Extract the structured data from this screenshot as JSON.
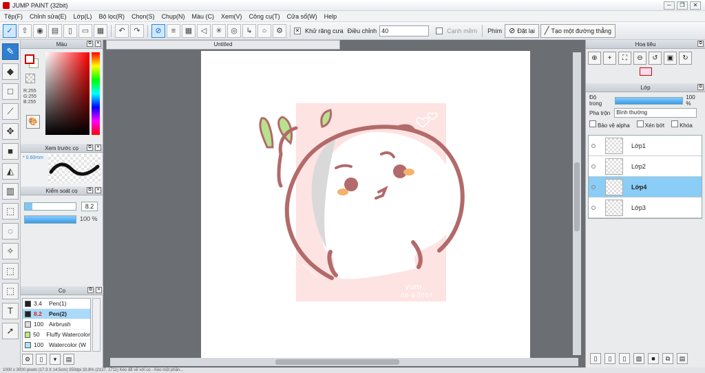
{
  "window": {
    "title": "JUMP PAINT (32bit)",
    "minimize": "─",
    "restore": "❐",
    "close": "✕"
  },
  "menu": [
    "Tệp(F)",
    "Chỉnh sửa(E)",
    "Lớp(L)",
    "Bộ lọc(R)",
    "Chọn(S)",
    "Chụp(N)",
    "Màu (C)",
    "Xem(V)",
    "Công cụ(T)",
    "Cửa sổ(W)",
    "Help"
  ],
  "toolbar": {
    "antialias_label": "Khử răng cưa",
    "adjust_label": "Điều chỉnh",
    "adjust_value": "40",
    "smooth_label": "Cạnh mềm",
    "key_label": "Phím",
    "reset_label": "Đặt lại",
    "straight_line_label": "Tạo một đường thẳng"
  },
  "color_panel": {
    "title": "Màu",
    "r": "R:255",
    "g": "G:255",
    "b": "B:255"
  },
  "preview_panel": {
    "title": "Xem trước cọ",
    "size": "* 0.60mm"
  },
  "brush_control": {
    "title": "Kiểm soát cọ",
    "size_value": "8.2",
    "opacity_value": "100 %",
    "size_fraction": 0.15
  },
  "brush_panel": {
    "title": "Cọ",
    "items": [
      {
        "size": "3.4",
        "name": "Pen(1)",
        "color": "#222222"
      },
      {
        "size": "8.2",
        "name": "Pen(2)",
        "color": "#222222"
      },
      {
        "size": "100",
        "name": "Airbrush",
        "color": "#dddddd"
      },
      {
        "size": "50",
        "name": "Fluffy Watercolor",
        "color": "#b8e986"
      },
      {
        "size": "100",
        "name": "Watercolor (W",
        "color": "#a8e4f6"
      }
    ]
  },
  "document": {
    "tab": "Untitled",
    "signature": "yum",
    "date": "08-4-2017"
  },
  "navigator": {
    "title": "Hoa tiêu"
  },
  "layer_panel": {
    "title": "Lớp",
    "opacity_label": "Độ trong",
    "opacity_value": "100 %",
    "blend_label": "Pha trộn",
    "blend_value": "Bình thường",
    "protect_alpha": "Bảo vệ alpha",
    "clip": "Xén bớt",
    "lock": "Khóa",
    "layers": [
      "Lớp1",
      "Lớp2",
      "Lớp4",
      "Lớp3"
    ]
  },
  "status": "1000 x 3000 pixels (17.3 X 14.5cm) 350dpi 33.8% (2127, 1711) Kéo để vẽ với cọ - Kéo một phần..."
}
